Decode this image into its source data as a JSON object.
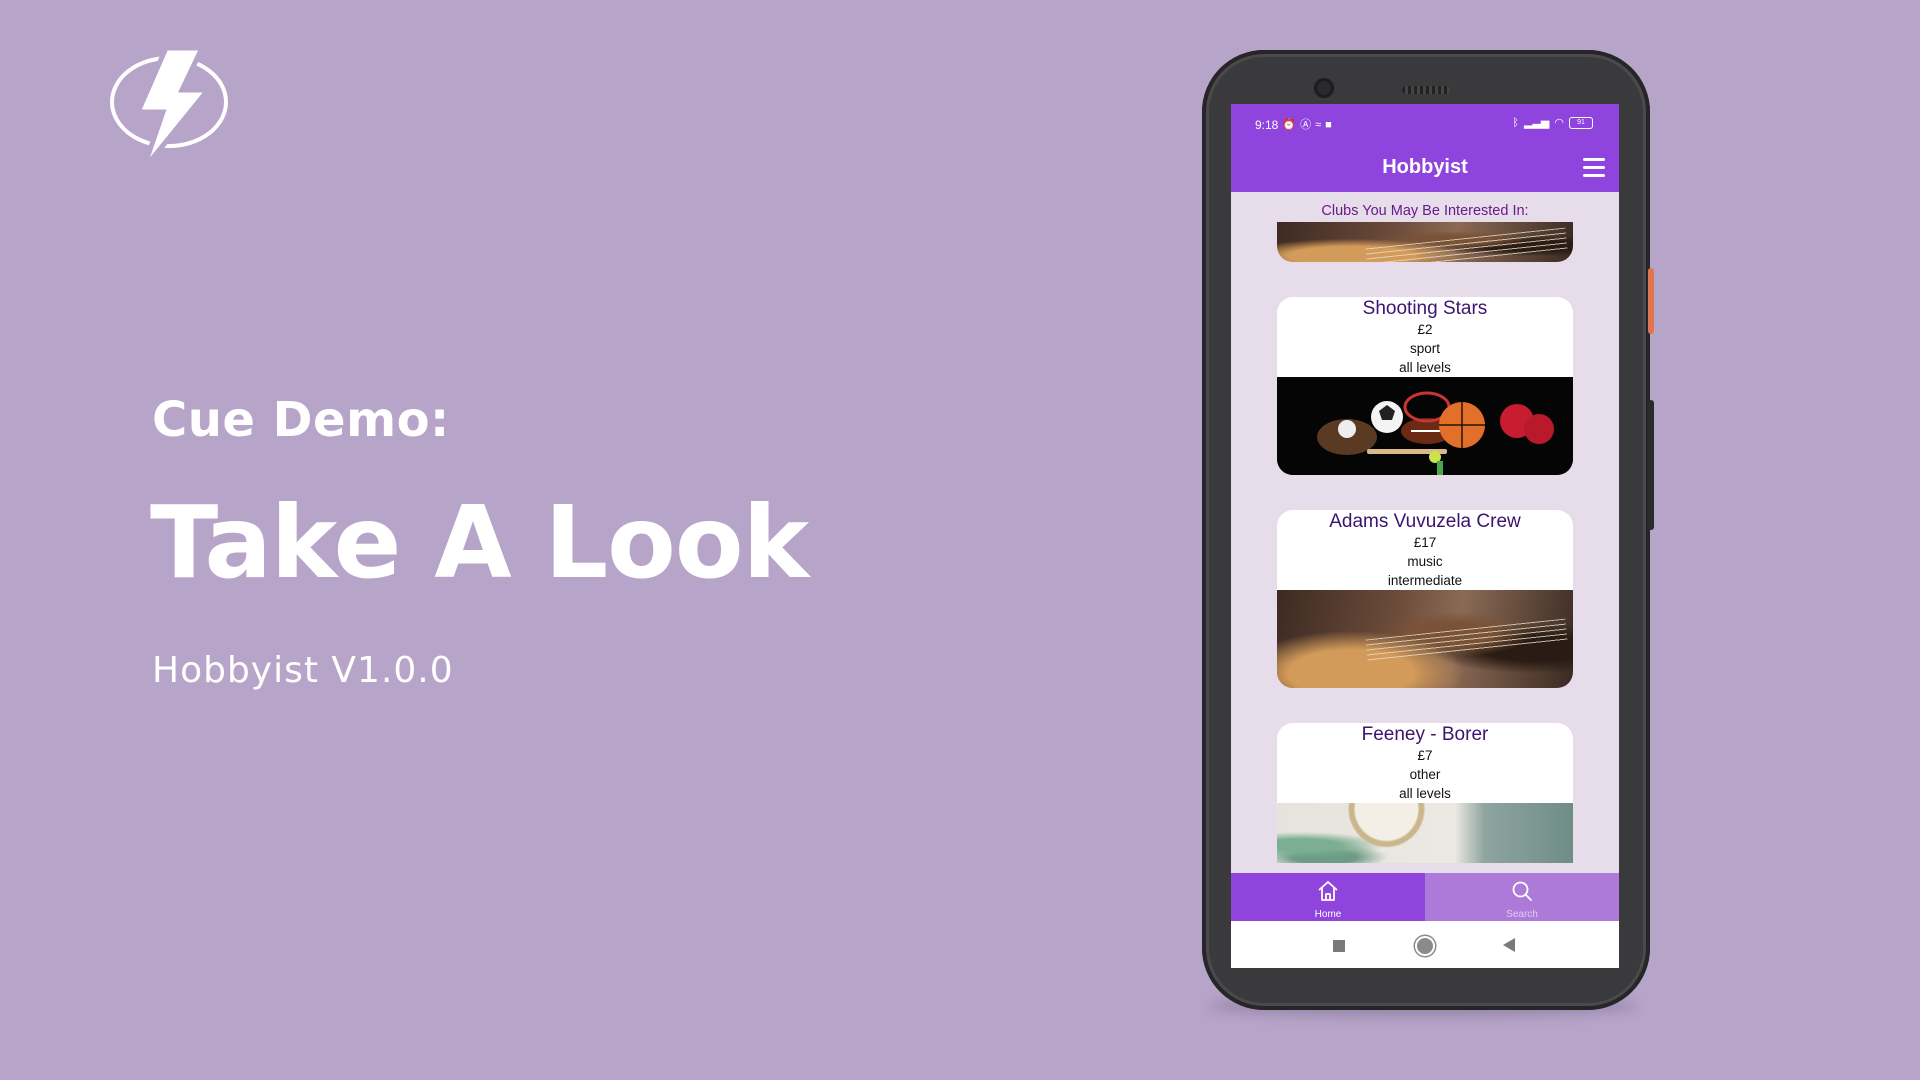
{
  "slide": {
    "kicker": "Cue Demo:",
    "headline": "Take A Look",
    "version": "Hobbyist V1.0.0",
    "background_color": "#b7a4c9",
    "logo_icon": "lightning-bolt-icon"
  },
  "phone": {
    "status_bar": {
      "time": "9:18",
      "battery": "91",
      "icons": [
        "alarm-icon",
        "a-icon",
        "hotspot-icon",
        "video-icon",
        "bluetooth-icon",
        "signal-icon",
        "wifi-icon",
        "battery-icon"
      ]
    },
    "app_bar": {
      "title": "Hobbyist",
      "menu_icon": "hamburger-menu-icon",
      "color": "#8e44dd"
    },
    "section_title": "Clubs You May Be Interested In:",
    "clubs": [
      {
        "name": "Shooting Stars",
        "price": "£2",
        "category": "sport",
        "level": "all levels",
        "image": "sports-equipment"
      },
      {
        "name": "Adams Vuvuzela Crew",
        "price": "£17",
        "category": "music",
        "level": "intermediate",
        "image": "guitar"
      },
      {
        "name": "Feeney - Borer",
        "price": "£7",
        "category": "other",
        "level": "all levels",
        "image": "crafts"
      }
    ],
    "bottom_nav": {
      "home_label": "Home",
      "search_label": "Search",
      "active": "Home"
    }
  }
}
